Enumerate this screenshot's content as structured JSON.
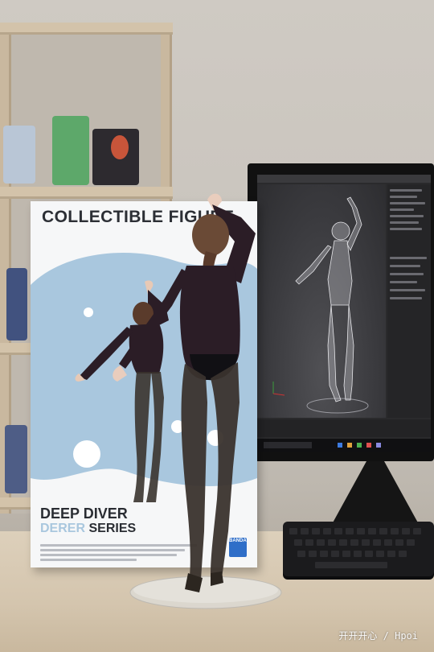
{
  "box": {
    "title": "COLLECTIBLE FIGURE",
    "line1": "DEEP DIVER",
    "line2_accent": "DERER",
    "line2_word": "SERIES",
    "brand_label": "BANDAI"
  },
  "photo": {
    "watermark": "开开开心 / Hpoi"
  },
  "colors": {
    "box_accent": "#a9c7de",
    "bodysuit": "#2b1d26",
    "tights": "#3a332d",
    "wall": "#cfcac3"
  }
}
